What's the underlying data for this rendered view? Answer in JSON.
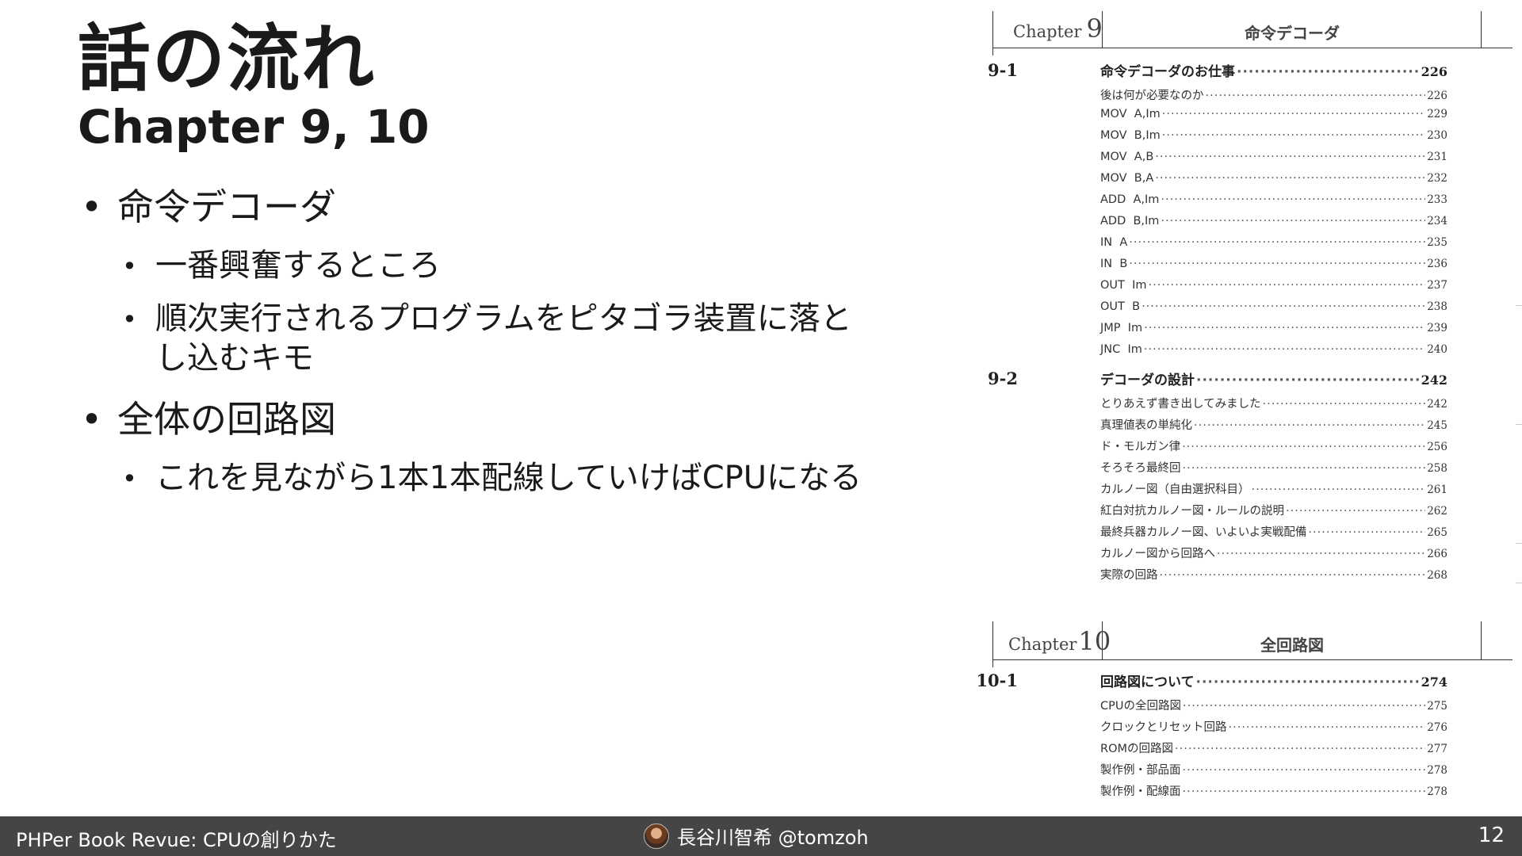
{
  "slide": {
    "title": "話の流れ",
    "subtitle": "Chapter 9, 10",
    "bullets": [
      {
        "text": "命令デコーダ",
        "sub": [
          "一番興奮するところ",
          "順次実行されるプログラムをピタゴラ装置に落とし込むキモ"
        ]
      },
      {
        "text": "全体の回路図",
        "sub": [
          "これを見ながら1本1本配線していけばCPUになる"
        ]
      }
    ]
  },
  "toc": {
    "chapter9": {
      "label_word": "Chapter",
      "label_num": "9",
      "title": "命令デコーダ",
      "sections": [
        {
          "num": "9-1",
          "title": "命令デコーダのお仕事",
          "page": "226",
          "items": [
            {
              "title": "後は何が必要なのか",
              "page": "226"
            },
            {
              "title": "MOV  A,Im",
              "page": "229"
            },
            {
              "title": "MOV  B,Im",
              "page": "230"
            },
            {
              "title": "MOV  A,B",
              "page": "231"
            },
            {
              "title": "MOV  B,A",
              "page": "232"
            },
            {
              "title": "ADD  A,Im",
              "page": "233"
            },
            {
              "title": "ADD  B,Im",
              "page": "234"
            },
            {
              "title": "IN  A",
              "page": "235"
            },
            {
              "title": "IN  B",
              "page": "236"
            },
            {
              "title": "OUT  Im",
              "page": "237"
            },
            {
              "title": "OUT  B",
              "page": "238"
            },
            {
              "title": "JMP  Im",
              "page": "239"
            },
            {
              "title": "JNC  Im",
              "page": "240"
            }
          ]
        },
        {
          "num": "9-2",
          "title": "デコーダの設計",
          "page": "242",
          "items": [
            {
              "title": "とりあえず書き出してみました",
              "page": "242"
            },
            {
              "title": "真理値表の単純化",
              "page": "245"
            },
            {
              "title": "ド・モルガン律",
              "page": "256"
            },
            {
              "title": "そろそろ最終回",
              "page": "258"
            },
            {
              "title": "カルノー図（自由選択科目）",
              "page": "261"
            },
            {
              "title": "紅白対抗カルノー図・ルールの説明",
              "page": "262"
            },
            {
              "title": "最終兵器カルノー図、いよいよ実戦配備",
              "page": "265"
            },
            {
              "title": "カルノー図から回路へ",
              "page": "266"
            },
            {
              "title": "実際の回路",
              "page": "268"
            }
          ]
        }
      ]
    },
    "chapter10": {
      "label_word": "Chapter",
      "label_num": "10",
      "title": "全回路図",
      "sections": [
        {
          "num": "10-1",
          "title": "回路図について",
          "page": "274",
          "items": [
            {
              "title": "CPUの全回路図",
              "page": "275"
            },
            {
              "title": "クロックとリセット回路",
              "page": "276"
            },
            {
              "title": "ROMの回路図",
              "page": "277"
            },
            {
              "title": "製作例・部品面",
              "page": "278"
            },
            {
              "title": "製作例・配線面",
              "page": "278"
            }
          ]
        }
      ]
    }
  },
  "footer": {
    "left": "PHPer Book Revue: CPUの創りかた",
    "author": "長谷川智希 @tomzoh",
    "page_number": "12"
  }
}
